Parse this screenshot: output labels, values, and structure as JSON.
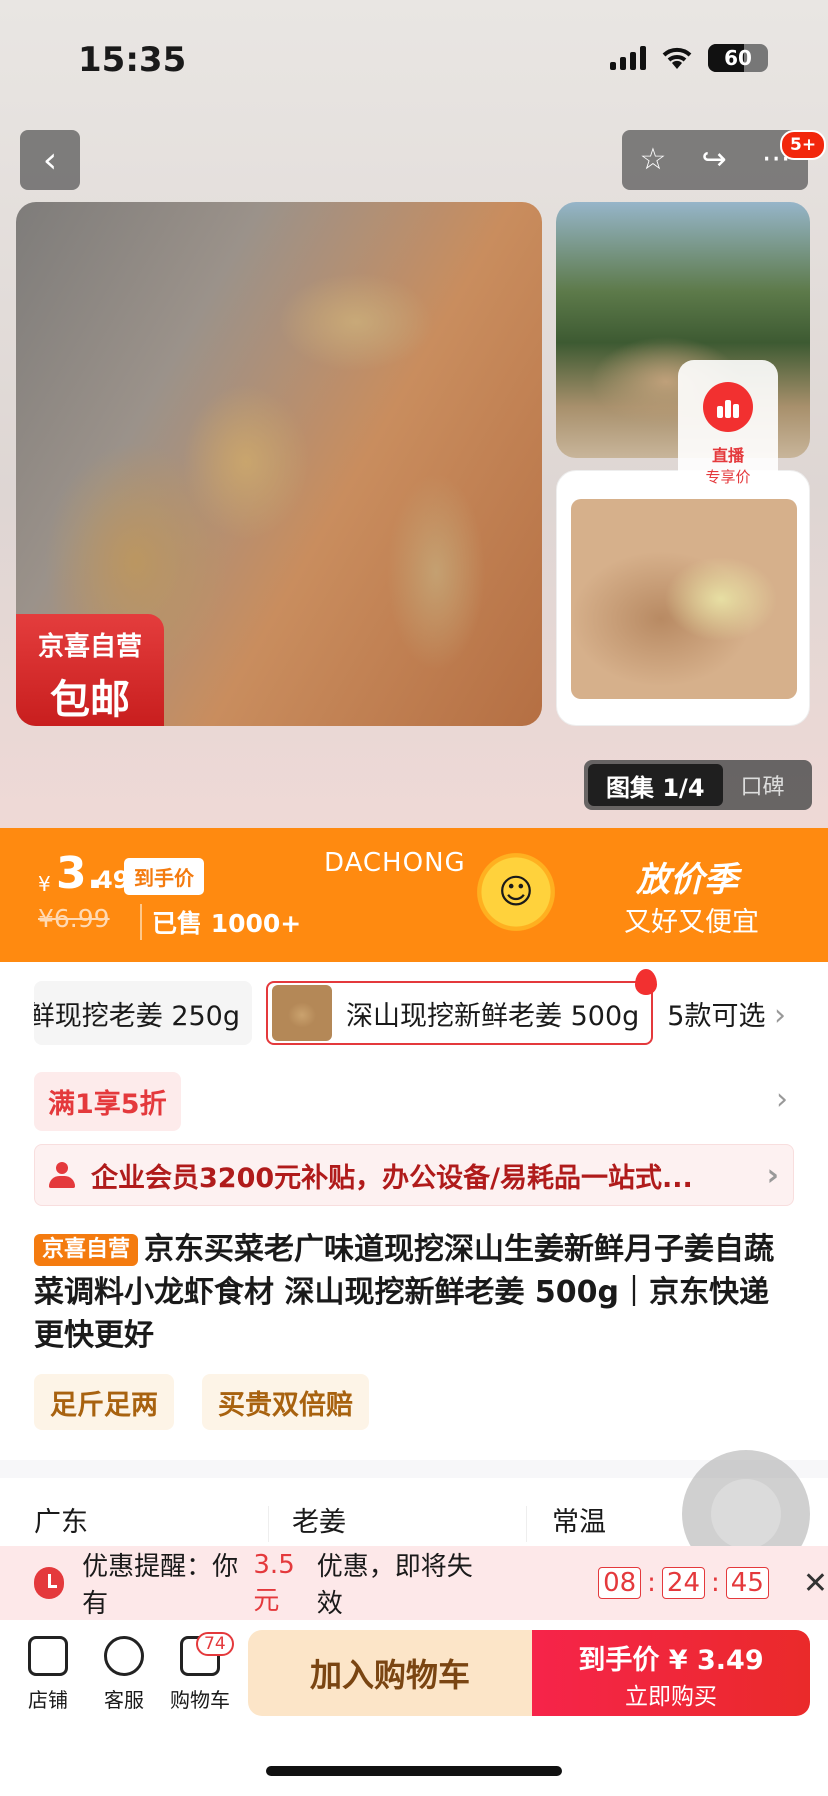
{
  "status": {
    "time": "15:35",
    "battery": "60"
  },
  "nav": {
    "back_icon": "chevron-left-icon",
    "badge": "5+"
  },
  "hero": {
    "tag_line1": "京喜自营",
    "tag_line2": "包邮",
    "live_line1": "直播",
    "live_line2": "专享价",
    "gallery_label": "图集 1/4",
    "review_label": "口碑"
  },
  "price": {
    "currency": "¥",
    "integer": "3.",
    "decimal": "49",
    "final_label": "到手价",
    "original": "¥6.99",
    "sold": "已售 1000+",
    "brand": "DACHONG",
    "campaign_title": "放价季",
    "campaign_sub": "又好又便宜"
  },
  "specs": {
    "item1": "鲜现挖老姜 250g",
    "item2": "深山现挖新鲜老姜 500g",
    "more": "5款可选"
  },
  "promo": {
    "label": "满1享5折"
  },
  "vip": {
    "text": "企业会员3200元补贴，办公设备/易耗品一站式..."
  },
  "product": {
    "self_tag": "京喜自营",
    "title": "京东买菜老广味道现挖深山生姜新鲜月子姜自蔬菜调料小龙虾食材 深山现挖新鲜老姜 500g｜京东快递 更快更好"
  },
  "services": [
    "足斤足两",
    "买贵双倍赔"
  ],
  "attributes": [
    "广东",
    "老姜",
    "常温"
  ],
  "reminder": {
    "prefix": "优惠提醒：你有",
    "amount": "3.5元",
    "suffix": "优惠，即将失效",
    "h": "08",
    "m": "24",
    "s": "45"
  },
  "bottom": {
    "store": "店铺",
    "service": "客服",
    "cart": "购物车",
    "cart_count": "74",
    "add_cart": "加入购物车",
    "buy_label": "到手价",
    "buy_price": "¥ 3.49",
    "buy_action": "立即购买"
  },
  "colors": {
    "accent": "#ff8a10",
    "red": "#e4393c"
  }
}
